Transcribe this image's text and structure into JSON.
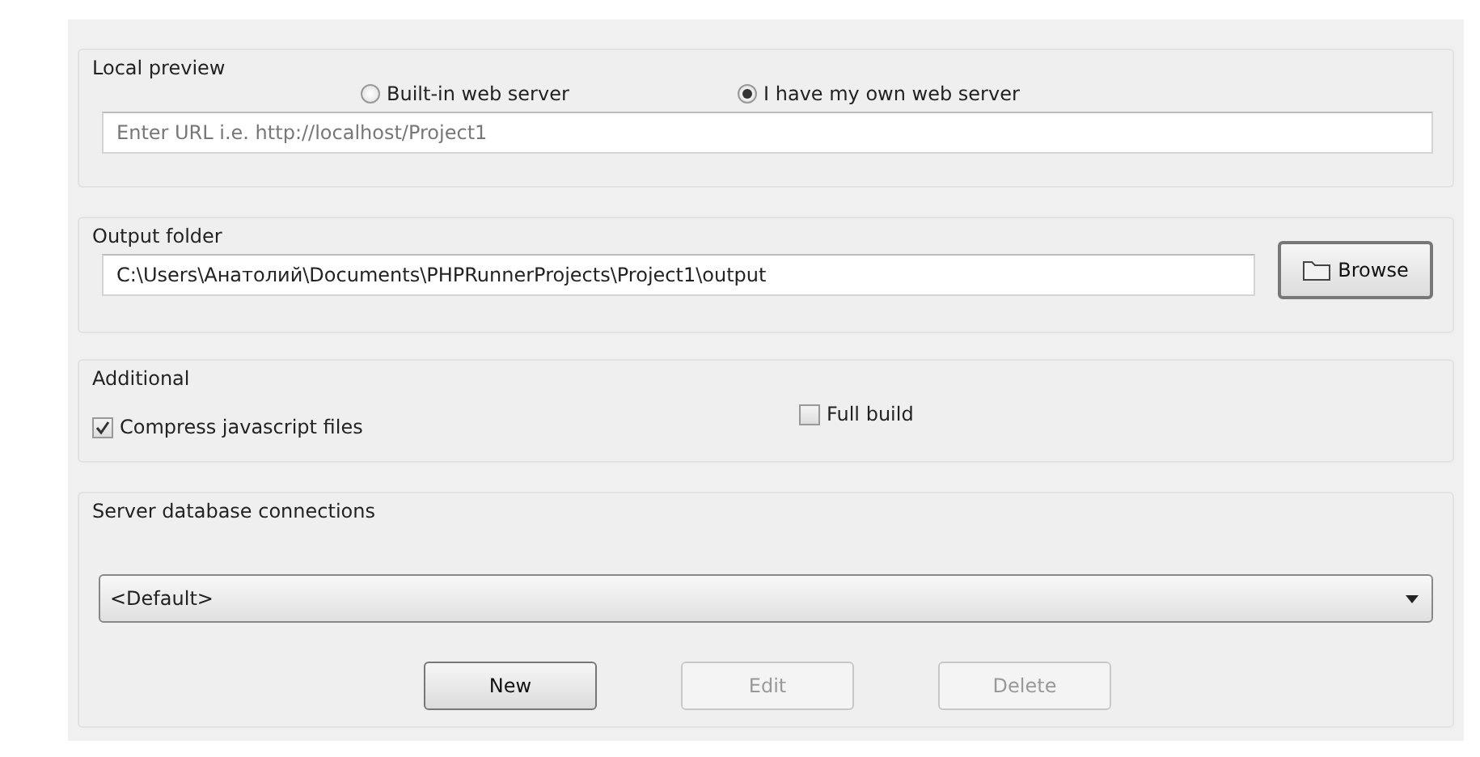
{
  "local_preview": {
    "title": "Local preview",
    "radios": [
      {
        "label": "Built-in web server",
        "selected": false
      },
      {
        "label": "I have my own web server",
        "selected": true
      }
    ],
    "url_field": {
      "placeholder": "Enter URL i.e. http://localhost/Project1"
    }
  },
  "output_folder": {
    "title": "Output folder",
    "path_field": {
      "value": "C:\\Users\\Анатолий\\Documents\\PHPRunnerProjects\\Project1\\output"
    },
    "browse_button": "Browse"
  },
  "additional": {
    "title": "Additional",
    "checkboxes": [
      {
        "label": "Compress javascript files",
        "checked": true
      },
      {
        "label": "Full build",
        "checked": false
      }
    ]
  },
  "server_database_connections": {
    "title": "Server database connections",
    "dropdown": {
      "value": "<Default>"
    },
    "buttons": [
      {
        "label": "New",
        "disabled": false
      },
      {
        "label": "Edit",
        "disabled": true
      },
      {
        "label": "Delete",
        "disabled": true
      }
    ]
  }
}
